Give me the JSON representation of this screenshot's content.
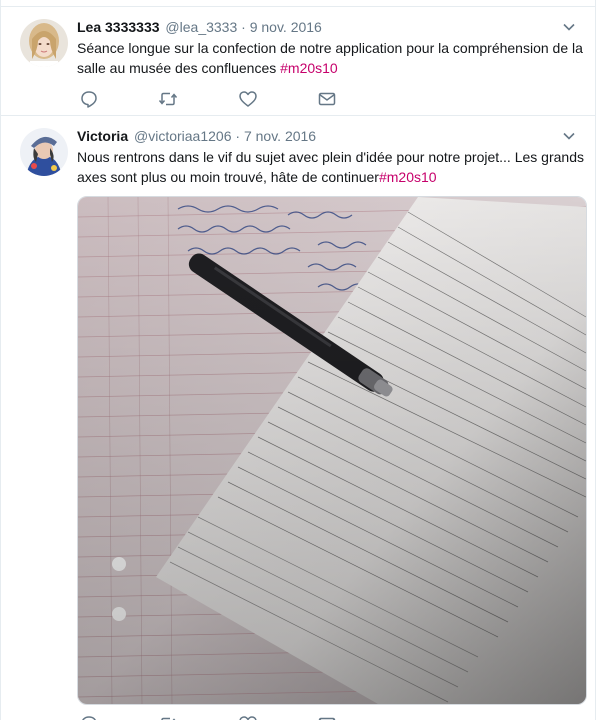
{
  "tweets": [
    {
      "name": "Lea 3333333",
      "handle": "@lea_3333",
      "separator": "·",
      "date": "9 nov. 2016",
      "text": "Séance longue sur la confection de notre application pour la compréhension de la salle au musée des confluences ",
      "hashtag": "#m20s10",
      "icons": [
        "caret-down-icon",
        "reply-icon",
        "retweet-icon",
        "heart-icon",
        "envelope-icon"
      ]
    },
    {
      "name": "Victoria",
      "handle": "@victoriaa1206",
      "separator": "·",
      "date": "7 nov. 2016",
      "text": "Nous rentrons dans le vif du sujet avec plein d'idée pour notre projet... Les grands axes sont plus ou moin trouvé, hâte de continuer",
      "hashtag": "#m20s10",
      "icons": [
        "caret-down-icon",
        "reply-icon",
        "retweet-icon",
        "heart-icon",
        "envelope-icon"
      ]
    }
  ],
  "colors": {
    "hashtag": "#c6006b",
    "secondary_text": "#657786",
    "icon": "#657786",
    "divider": "#e6ecf0"
  }
}
